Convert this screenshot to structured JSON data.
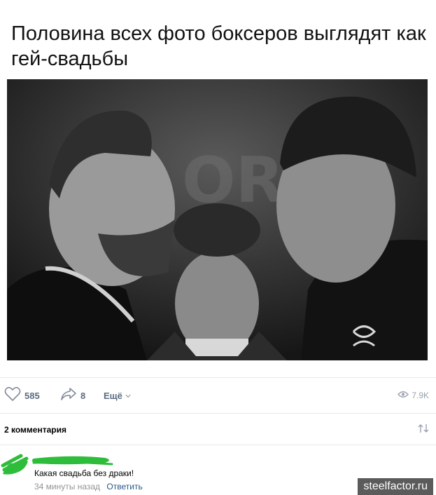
{
  "post": {
    "title": "Половина всех фото боксеров выглядят как гей-свадьбы"
  },
  "actions": {
    "likes": "585",
    "shares": "8",
    "more_label": "Ещё",
    "views": "7.9K"
  },
  "comments": {
    "header": "2 комментария",
    "items": [
      {
        "text": "Какая свадьба без драки!",
        "time": "34 минуты назад",
        "reply_label": "Ответить"
      }
    ]
  },
  "watermark": "steelfactor.ru",
  "colors": {
    "action_text": "#5d6d80",
    "link": "#2a5885",
    "redact_green": "#2ebd3b"
  }
}
